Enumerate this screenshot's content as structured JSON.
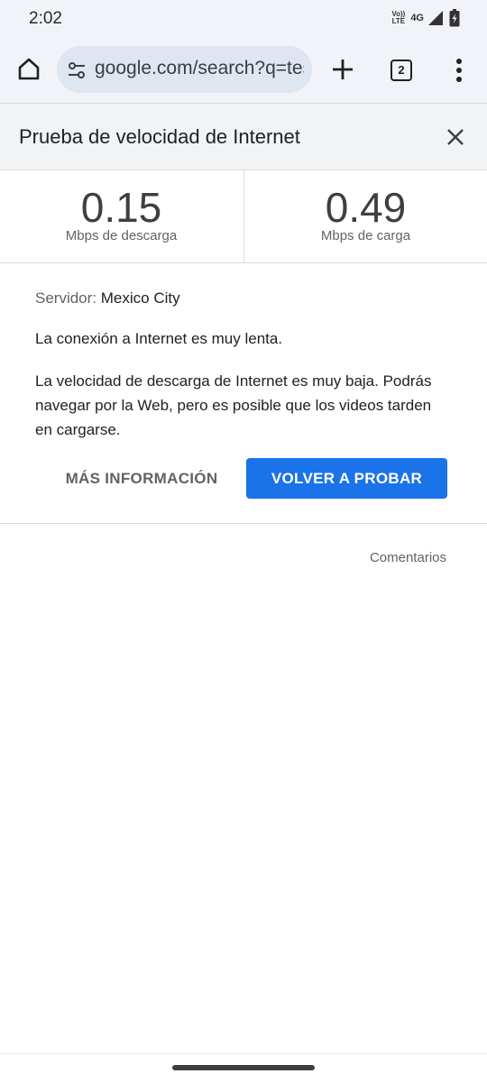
{
  "status_bar": {
    "time": "2:02",
    "volte_top": "Vo))",
    "volte_bottom": "LTE",
    "network": "4G"
  },
  "toolbar": {
    "url": "google.com/search?q=test+de+velocidad",
    "tab_count": "2"
  },
  "speed_test": {
    "title": "Prueba de velocidad de Internet",
    "download_value": "0.15",
    "download_unit": "Mbps de descarga",
    "upload_value": "0.49",
    "upload_unit": "Mbps de carga",
    "server_label": "Servidor:",
    "server_value": "Mexico City",
    "connection_message": "La conexión a Internet es muy lenta.",
    "description": "La velocidad de descarga de Internet es muy baja. Podrás navegar por la Web, pero es posible que los videos tarden en cargarse.",
    "more_info_label": "MÁS INFORMACIÓN",
    "retry_label": "VOLVER A PROBAR",
    "feedback_label": "Comentarios"
  },
  "colors": {
    "accent": "#1a73e8",
    "toolbar_bg": "#f1f3f8",
    "omnibox_bg": "#dfe6f1"
  },
  "icons": [
    "home-icon",
    "tune-icon",
    "plus-icon",
    "tab-switcher-icon",
    "more-vert-icon",
    "close-icon",
    "signal-icon",
    "battery-icon"
  ]
}
